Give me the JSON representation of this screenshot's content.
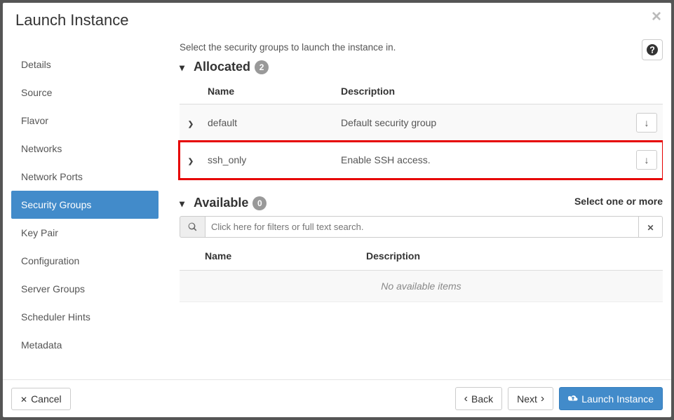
{
  "modal": {
    "title": "Launch Instance"
  },
  "sidebar": {
    "items": [
      {
        "label": "Details"
      },
      {
        "label": "Source"
      },
      {
        "label": "Flavor"
      },
      {
        "label": "Networks"
      },
      {
        "label": "Network Ports"
      },
      {
        "label": "Security Groups",
        "active": true
      },
      {
        "label": "Key Pair"
      },
      {
        "label": "Configuration"
      },
      {
        "label": "Server Groups"
      },
      {
        "label": "Scheduler Hints"
      },
      {
        "label": "Metadata"
      }
    ]
  },
  "main": {
    "help_text": "Select the security groups to launch the instance in.",
    "allocated": {
      "label": "Allocated",
      "count": "2",
      "columns": {
        "name": "Name",
        "description": "Description"
      },
      "rows": [
        {
          "name": "default",
          "description": "Default security group"
        },
        {
          "name": "ssh_only",
          "description": "Enable SSH access.",
          "highlight": true
        }
      ]
    },
    "available": {
      "label": "Available",
      "count": "0",
      "hint": "Select one or more",
      "search_placeholder": "Click here for filters or full text search.",
      "columns": {
        "name": "Name",
        "description": "Description"
      },
      "empty": "No available items"
    }
  },
  "footer": {
    "cancel": "Cancel",
    "back": "Back",
    "next": "Next",
    "launch": "Launch Instance"
  }
}
